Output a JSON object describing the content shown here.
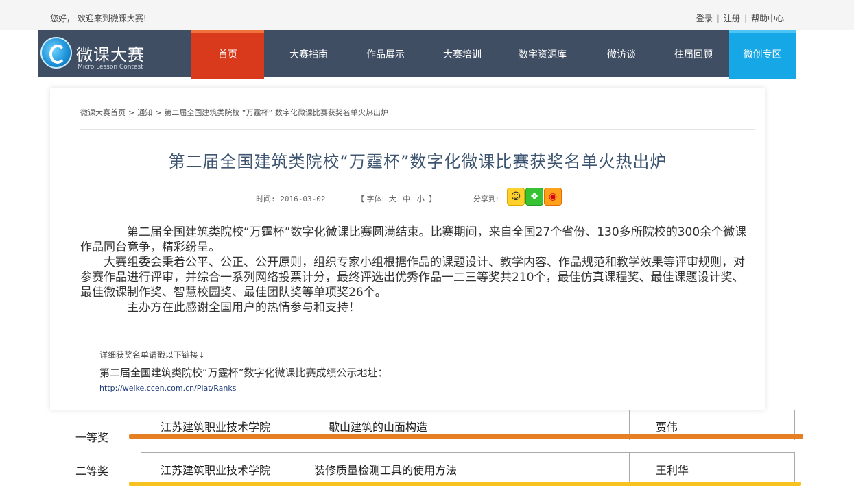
{
  "topbar": {
    "welcome": "您好， 欢迎来到微课大赛!",
    "login": "登录",
    "register": "注册",
    "help": "帮助中心",
    "sep": "|"
  },
  "logo": {
    "title": "微课大赛",
    "subtitle": "Micro Lesson Contest"
  },
  "nav": {
    "items": [
      {
        "label": "首页",
        "active": true
      },
      {
        "label": "大赛指南"
      },
      {
        "label": "作品展示"
      },
      {
        "label": "大赛培训"
      },
      {
        "label": "数字资源库"
      },
      {
        "label": "微访谈"
      },
      {
        "label": "往届回顾"
      },
      {
        "label": "微创专区",
        "highlight": true
      }
    ],
    "colors": {
      "bar": "#3f4e63",
      "active": "#d93a1c",
      "special": "#16a8e6"
    }
  },
  "breadcrumb": {
    "home": "微课大赛首页",
    "section": "通知",
    "current": "第二届全国建筑类院校 “万霆杯” 数字化微课比赛获奖名单火热出炉",
    "sep": ">"
  },
  "article": {
    "title": "第二届全国建筑类院校“万霆杯”数字化微课比赛获奖名单火热出炉",
    "date": "时间: 2016-03-02",
    "font_label": "【 字体:",
    "font_large": "大",
    "font_medium": "中",
    "font_small": "小",
    "font_end": "】",
    "share_label": "分享到:",
    "share_icons": [
      "qq-icon",
      "wechat-icon",
      "weibo-icon"
    ],
    "paragraphs": [
      "第二届全国建筑类院校“万霆杯”数字化微课比赛圆满结束。比赛期间，来自全国27个省份、130多所院校的300余个微课作品同台竞争，精彩纷呈。",
      "大赛组委会秉着公平、公正、公开原则，组织专家小组根据作品的课题设计、教学内容、作品规范和教学效果等评审规则，对参赛作品进行评审，并综合一系列网络投票计分，最终评选出优秀作品一二三等奖共210个，最佳仿真课程奖、最佳课题设计奖、最佳微课制作奖、智慧校园奖、最佳团队奖等单项奖26个。",
      "主办方在此感谢全国用户的热情参与和支持！"
    ],
    "links_label": "详细获奖名单请戳以下链接↓",
    "links_title": "第二届全国建筑类院校“万霆杯”数字化微课比赛成绩公示地址：",
    "links_url": "http://weike.ccen.com.cn/Plat/Ranks"
  },
  "awards": [
    {
      "rank": "一等奖",
      "school": "江苏建筑职业技术学院",
      "work": "歇山建筑的山面构造",
      "author": "贾伟",
      "highlight": "#e67e22"
    },
    {
      "rank": "二等奖",
      "school": "江苏建筑职业技术学院",
      "work": "装修质量检测工具的使用方法",
      "author": "王利华",
      "highlight": "#f7c21f"
    }
  ]
}
